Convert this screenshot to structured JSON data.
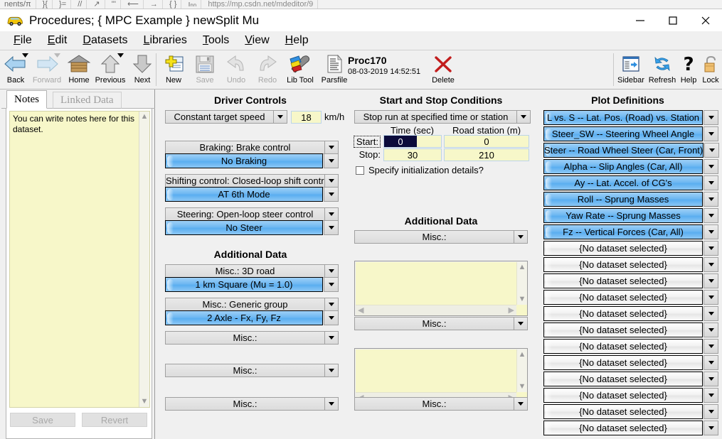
{
  "background_strip": {
    "segments": [
      "nents/π",
      "}{",
      "}=",
      "//",
      "↗",
      "'''",
      "⟵",
      "→",
      "{ }",
      "ıₙₙ"
    ],
    "url": "https://mp.csdn.net/mdeditor/9"
  },
  "window": {
    "title": "Procedures;  { MPC Example }  newSplit Mu",
    "icon": "car-icon",
    "minimize": "minimize-icon",
    "maximize": "maximize-icon",
    "close": "close-icon"
  },
  "menubar": {
    "items": [
      {
        "accel": "F",
        "rest": "ile"
      },
      {
        "accel": "E",
        "rest": "dit"
      },
      {
        "accel": "D",
        "rest": "atasets"
      },
      {
        "accel": "L",
        "rest": "ibraries"
      },
      {
        "accel": "T",
        "rest": "ools"
      },
      {
        "accel": "V",
        "rest": "iew"
      },
      {
        "accel": "H",
        "rest": "elp"
      }
    ]
  },
  "toolbar": {
    "buttons": [
      {
        "label": "Back",
        "icon": "back-arrow-icon",
        "enabled": true,
        "has_caret": true
      },
      {
        "label": "Forward",
        "icon": "forward-arrow-icon",
        "enabled": false,
        "has_caret": true
      },
      {
        "label": "Home",
        "icon": "home-icon",
        "enabled": true,
        "has_caret": false
      },
      {
        "label": "Previous",
        "icon": "up-arrow-icon",
        "enabled": true,
        "has_caret": true
      },
      {
        "label": "Next",
        "icon": "down-arrow-icon",
        "enabled": true,
        "has_caret": false
      },
      {
        "label": "New",
        "icon": "new-document-icon",
        "enabled": true,
        "has_caret": false
      },
      {
        "label": "Save",
        "icon": "floppy-disk-icon",
        "enabled": false,
        "has_caret": false
      },
      {
        "label": "Undo",
        "icon": "undo-arrow-icon",
        "enabled": false,
        "has_caret": false
      },
      {
        "label": "Redo",
        "icon": "redo-arrow-icon",
        "enabled": false,
        "has_caret": false
      },
      {
        "label": "Lib Tool",
        "icon": "wrench-icon",
        "enabled": true,
        "has_caret": false
      },
      {
        "label": "Parsfile",
        "icon": "parsfile-icon",
        "enabled": true,
        "has_caret": false
      }
    ],
    "proc_name": "Proc170",
    "proc_date": "08-03-2019 14:52:51",
    "delete": {
      "label": "Delete",
      "icon": "red-x-icon"
    },
    "right_buttons": [
      {
        "label": "Sidebar",
        "icon": "sidebar-icon"
      },
      {
        "label": "Refresh",
        "icon": "refresh-icon"
      },
      {
        "label": "Help",
        "icon": "question-mark-icon"
      },
      {
        "label": "Lock",
        "icon": "padlock-icon"
      }
    ]
  },
  "notes_panel": {
    "tabs": [
      {
        "label": "Notes",
        "active": true
      },
      {
        "label": "Linked Data",
        "active": false
      }
    ],
    "text": "You can write notes here for this dataset.",
    "buttons": [
      {
        "label": "Save"
      },
      {
        "label": "Revert"
      }
    ]
  },
  "driver_controls": {
    "title": "Driver Controls",
    "speed_mode": "Constant target speed",
    "speed_value": "18",
    "speed_unit": "km/h",
    "groups": [
      {
        "header": "Braking: Brake control",
        "dataset": "No Braking"
      },
      {
        "header": "Shifting control: Closed-loop shift control",
        "dataset": "AT 6th Mode"
      },
      {
        "header": "Steering: Open-loop steer control",
        "dataset": "No Steer"
      }
    ],
    "additional_title": "Additional Data",
    "additional": [
      {
        "header": "Misc.: 3D road",
        "dataset": "1 km Square (Mu = 1.0)"
      },
      {
        "header": "Misc.: Generic group",
        "dataset": "2 Axle - Fx, Fy, Fz"
      },
      {
        "header": "Misc.:",
        "dataset": null
      },
      {
        "header": "Misc.:",
        "dataset": null
      },
      {
        "header": "Misc.:",
        "dataset": null
      }
    ]
  },
  "start_stop": {
    "title": "Start and Stop Conditions",
    "mode": "Stop run at specified time or station",
    "col_headers": [
      "Time (sec)",
      "Road station (m)"
    ],
    "rows": [
      {
        "label": "Start:",
        "time": "0",
        "station": "0",
        "selected": true
      },
      {
        "label": "Stop:",
        "time": "30",
        "station": "210",
        "selected": false
      }
    ],
    "init_checkbox": {
      "label": "Specify initialization details?",
      "checked": false
    },
    "additional_title": "Additional Data",
    "additional": [
      {
        "header": "Misc.:"
      },
      {
        "header": "Misc.:"
      },
      {
        "header": "Misc.:"
      }
    ]
  },
  "plot_definitions": {
    "title": "Plot Definitions",
    "empty_label": "{No dataset selected}",
    "items": [
      {
        "label": "L vs. S -- Lat. Pos. (Road) vs. Station",
        "selected": true
      },
      {
        "label": "Steer_SW -- Steering Wheel Angle",
        "selected": true
      },
      {
        "label": "Steer -- Road Wheel Steer (Car, Front)",
        "selected": true
      },
      {
        "label": "Alpha -- Slip Angles (Car, All)",
        "selected": true
      },
      {
        "label": "Ay -- Lat. Accel. of CG's",
        "selected": true
      },
      {
        "label": "Roll -- Sprung Masses",
        "selected": true
      },
      {
        "label": "Yaw Rate -- Sprung Masses",
        "selected": true
      },
      {
        "label": "Fz -- Vertical Forces (Car, All)",
        "selected": true
      },
      {
        "label": "{No dataset selected}",
        "selected": false
      },
      {
        "label": "{No dataset selected}",
        "selected": false
      },
      {
        "label": "{No dataset selected}",
        "selected": false
      },
      {
        "label": "{No dataset selected}",
        "selected": false
      },
      {
        "label": "{No dataset selected}",
        "selected": false
      },
      {
        "label": "{No dataset selected}",
        "selected": false
      },
      {
        "label": "{No dataset selected}",
        "selected": false
      },
      {
        "label": "{No dataset selected}",
        "selected": false
      },
      {
        "label": "{No dataset selected}",
        "selected": false
      },
      {
        "label": "{No dataset selected}",
        "selected": false
      },
      {
        "label": "{No dataset selected}",
        "selected": false
      },
      {
        "label": "{No dataset selected}",
        "selected": false
      }
    ]
  },
  "colors": {
    "dataset_blue": "#6fb8f2",
    "notes_yellow": "#f7f7c9",
    "selection_navy": "#0b0b3b",
    "window_grey": "#f0f0f0"
  }
}
